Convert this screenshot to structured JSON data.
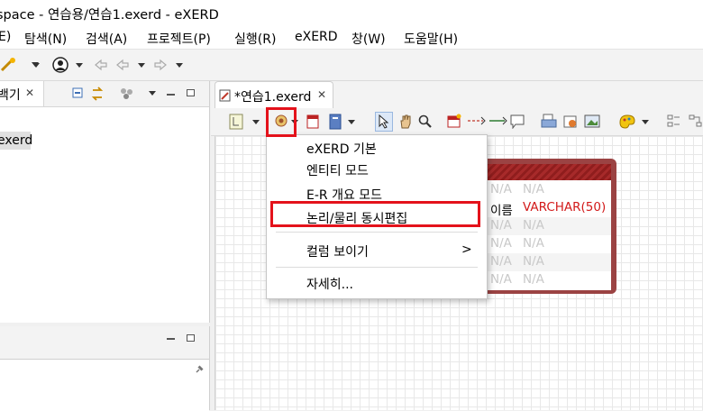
{
  "window": {
    "title": "space - 연습용/연습1.exerd - eXERD"
  },
  "menubar": {
    "items": [
      "E)",
      "탐색(N)",
      "검색(A)",
      "프로젝트(P)",
      "실행(R)",
      "eXERD",
      "창(W)",
      "도움말(H)"
    ]
  },
  "left_panel": {
    "tab_label": "백기",
    "tree_item": "exerd"
  },
  "editor": {
    "tab_label": "*연습1.exerd"
  },
  "dropdown": {
    "items": [
      "eXERD 기본",
      "엔티티 모드",
      "E-R 개요 모드",
      "논리/물리 동시편집",
      "컬럼 보이기",
      "자세히..."
    ],
    "submenu_arrow": ">"
  },
  "entity": {
    "rows": [
      {
        "left": "N/A",
        "right": "N/A"
      },
      {
        "left": "이름",
        "right": "VARCHAR(50)"
      },
      {
        "left": "N/A",
        "right": "N/A"
      },
      {
        "left": "N/A",
        "right": "N/A"
      },
      {
        "left": "N/A",
        "right": "N/A"
      },
      {
        "left": "N/A",
        "right": "N/A"
      }
    ]
  },
  "colors": {
    "highlight": "#e4121b",
    "entity_header": "#a72a2a",
    "type_text": "#d21a1a"
  },
  "icons": {
    "tab_close": "close-icon",
    "editor_file": "erd-file-icon",
    "pin": "pin-icon"
  }
}
